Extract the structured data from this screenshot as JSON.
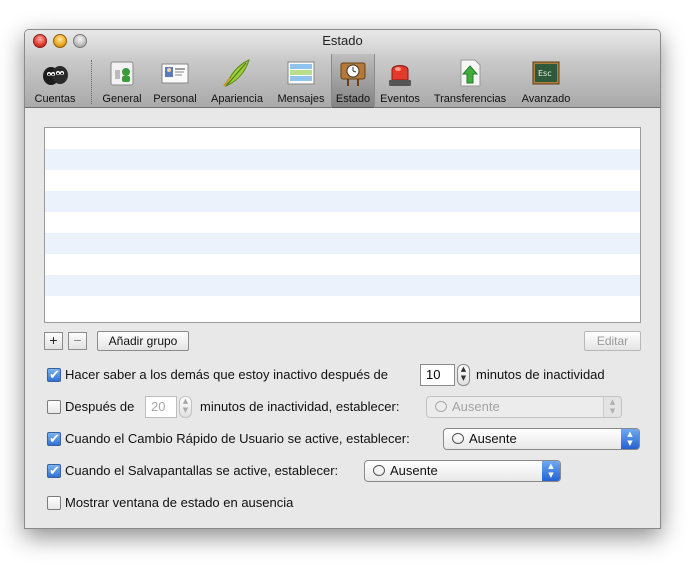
{
  "window": {
    "title": "Estado"
  },
  "toolbar": {
    "items": [
      {
        "label": "Cuentas",
        "icon": "accounts-icon"
      },
      {
        "label": "General",
        "icon": "general-icon"
      },
      {
        "label": "Personal",
        "icon": "personal-icon"
      },
      {
        "label": "Apariencia",
        "icon": "appearance-icon"
      },
      {
        "label": "Mensajes",
        "icon": "messages-icon"
      },
      {
        "label": "Estado",
        "icon": "status-icon",
        "selected": true
      },
      {
        "label": "Eventos",
        "icon": "events-icon"
      },
      {
        "label": "Transferencias",
        "icon": "transfers-icon"
      },
      {
        "label": "Avanzado",
        "icon": "advanced-icon"
      }
    ]
  },
  "list": {
    "rows": 9
  },
  "buttons": {
    "add": "+",
    "remove": "−",
    "add_group": "Añadir grupo",
    "edit": "Editar"
  },
  "options": {
    "idle": {
      "checked": true,
      "before": "Hacer saber a los demás que estoy inactivo después de",
      "value": "10",
      "after": "minutos de inactividad"
    },
    "after_idle": {
      "checked": false,
      "before": "Después de",
      "value": "20",
      "after": "minutos de inactividad, establecer:",
      "status": "Ausente"
    },
    "fast_user": {
      "checked": true,
      "label": "Cuando el Cambio Rápido de Usuario se active, establecer:",
      "status": "Ausente"
    },
    "screensaver": {
      "checked": true,
      "label": "Cuando el Salvapantallas se active, establecer:",
      "status": "Ausente"
    },
    "show_window": {
      "checked": false,
      "label": "Mostrar ventana de estado en ausencia"
    }
  },
  "colors": {
    "accent": "#2f73d6",
    "list_stripe": "#ecf2fb"
  }
}
